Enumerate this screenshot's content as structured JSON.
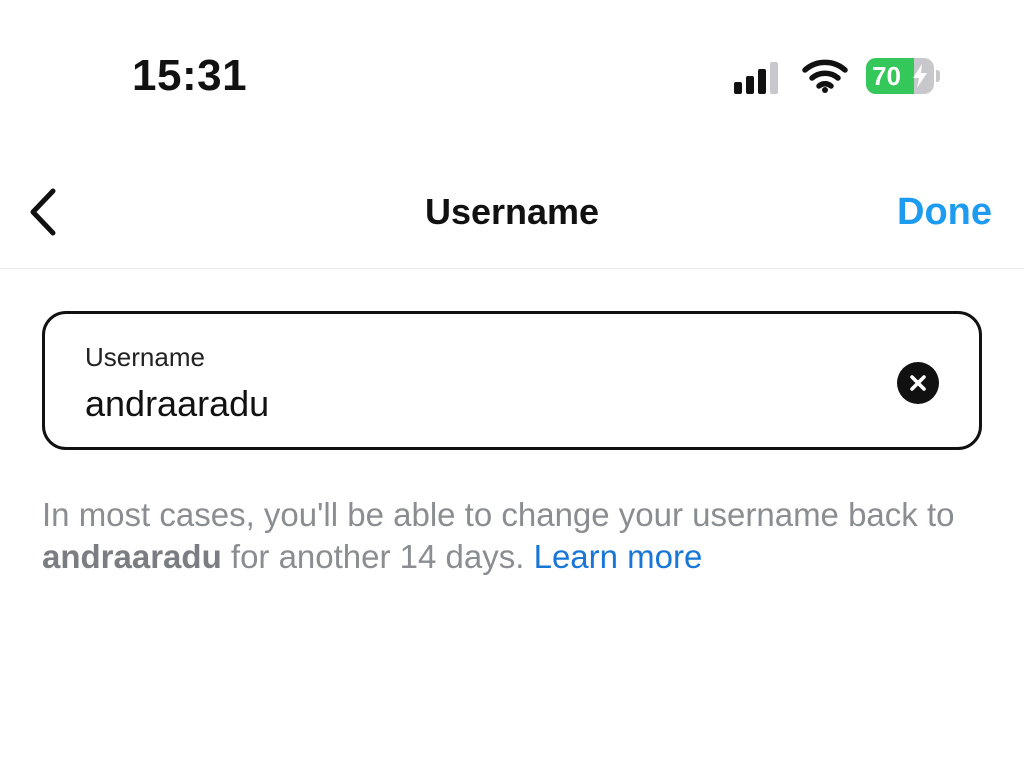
{
  "status_bar": {
    "time": "15:31",
    "battery_percent": 70,
    "battery_label": "70",
    "charging": true,
    "icons": [
      "signal-icon",
      "wifi-icon",
      "battery-icon",
      "bolt-icon"
    ],
    "colors": {
      "battery_fill": "#34c759"
    }
  },
  "nav": {
    "back_icon": "chevron-left-icon",
    "title": "Username",
    "done_label": "Done",
    "colors": {
      "done": "#1d9bf0"
    }
  },
  "field": {
    "label": "Username",
    "value": "andraaradu",
    "clear_icon": "clear-icon"
  },
  "helper": {
    "text_before": "In most cases, you'll be able to change your username back to ",
    "username": "andraaradu",
    "text_after": " for another 14 days. ",
    "link_label": "Learn more",
    "colors": {
      "link": "#1877d6"
    }
  }
}
